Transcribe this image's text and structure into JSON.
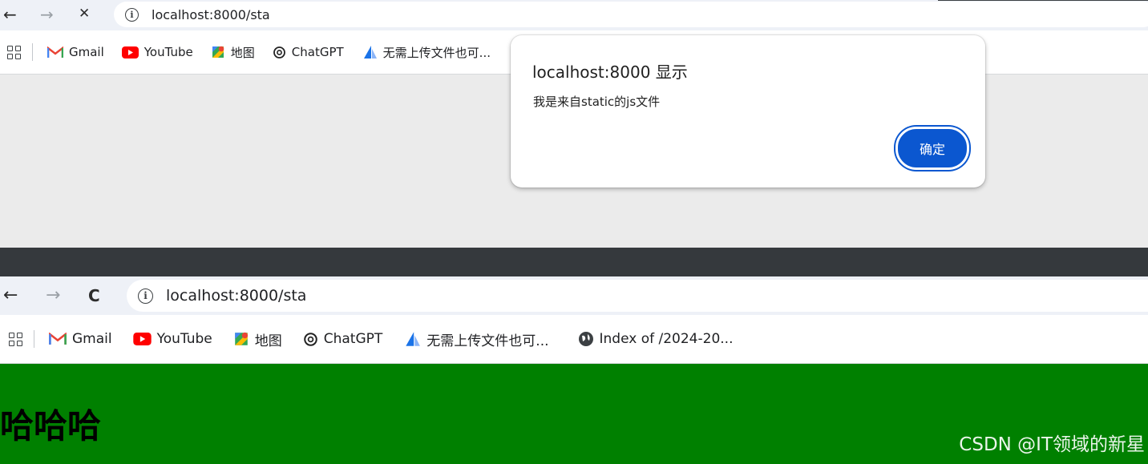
{
  "top_window": {
    "url": "localhost:8000/sta",
    "nav": {
      "back": "←",
      "forward": "→",
      "stop": "✕"
    },
    "bookmarks": [
      {
        "label": "Gmail",
        "icon": "gmail-icon"
      },
      {
        "label": "YouTube",
        "icon": "youtube-icon"
      },
      {
        "label": "地图",
        "icon": "maps-icon"
      },
      {
        "label": "ChatGPT",
        "icon": "chatgpt-icon"
      },
      {
        "label": "无需上传文件也可...",
        "icon": "sail-icon"
      }
    ],
    "dialog": {
      "title": "localhost:8000 显示",
      "message": "我是来自static的js文件",
      "ok_label": "确定"
    }
  },
  "bottom_window": {
    "url": "localhost:8000/sta",
    "nav": {
      "back": "←",
      "forward": "→",
      "reload": "C"
    },
    "bookmarks": [
      {
        "label": "Gmail",
        "icon": "gmail-icon"
      },
      {
        "label": "YouTube",
        "icon": "youtube-icon"
      },
      {
        "label": "地图",
        "icon": "maps-icon"
      },
      {
        "label": "ChatGPT",
        "icon": "chatgpt-icon"
      },
      {
        "label": "无需上传文件也可...",
        "icon": "sail-icon"
      },
      {
        "label": "Index of /2024-20...",
        "icon": "globe-icon"
      }
    ],
    "page": {
      "heading": "哈哈哈",
      "background_color": "#008000"
    }
  },
  "watermark": "CSDN @IT领域的新星",
  "colors": {
    "dialog_button": "#0b57d0",
    "toolbar_bg": "#eef1f7",
    "divider": "#35393d"
  }
}
